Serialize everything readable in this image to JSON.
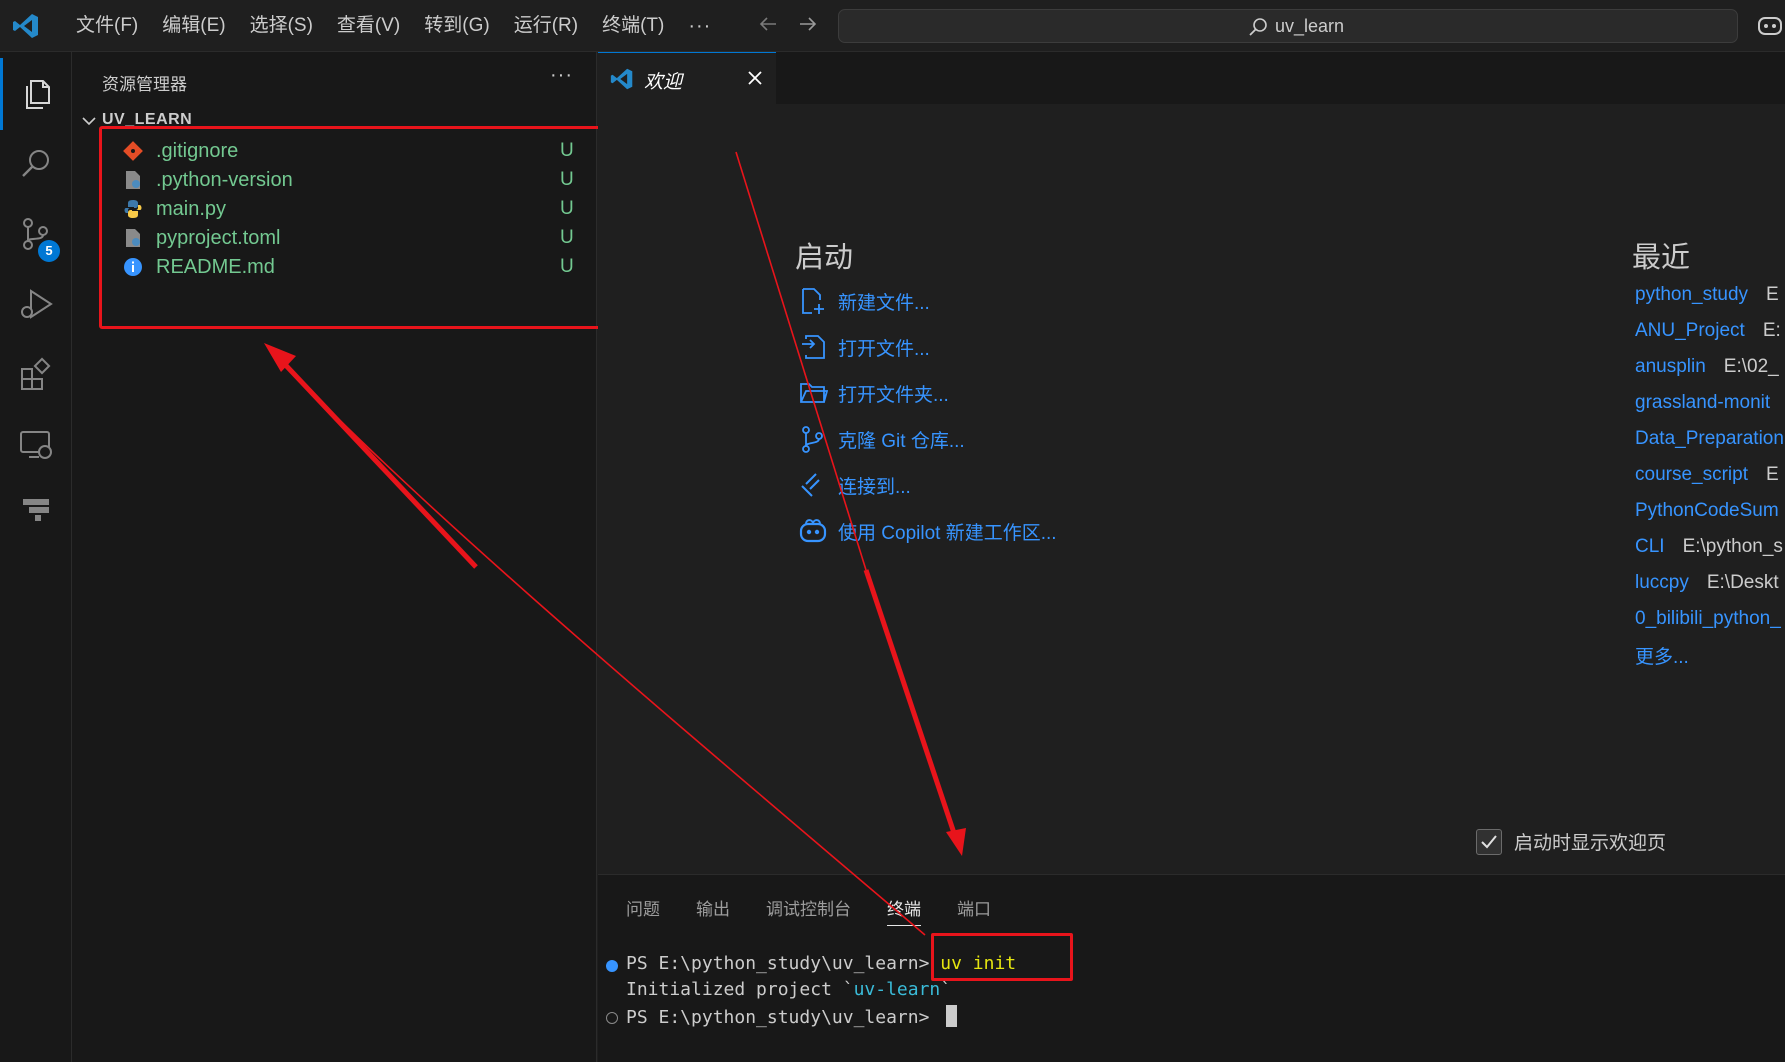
{
  "titlebar": {
    "menus": [
      "文件(F)",
      "编辑(E)",
      "选择(S)",
      "查看(V)",
      "转到(G)",
      "运行(R)",
      "终端(T)"
    ],
    "more": "···",
    "search_text": "uv_learn"
  },
  "activity": {
    "scm_badge": "5"
  },
  "sidebar": {
    "title": "资源管理器",
    "more": "···",
    "folder": "UV_LEARN",
    "files": [
      {
        "name": ".gitignore",
        "status": "U",
        "icon": "git-icon"
      },
      {
        "name": ".python-version",
        "status": "U",
        "icon": "settings-file-icon"
      },
      {
        "name": "main.py",
        "status": "U",
        "icon": "python-icon"
      },
      {
        "name": "pyproject.toml",
        "status": "U",
        "icon": "settings-file-icon"
      },
      {
        "name": "README.md",
        "status": "U",
        "icon": "info-icon"
      }
    ]
  },
  "editor": {
    "tab_label": "欢迎"
  },
  "welcome": {
    "start_title": "启动",
    "start_items": [
      "新建文件...",
      "打开文件...",
      "打开文件夹...",
      "克隆 Git 仓库...",
      "连接到...",
      "使用 Copilot 新建工作区..."
    ],
    "recent_title": "最近",
    "recent": [
      {
        "name": "python_study",
        "path": "E"
      },
      {
        "name": "ANU_Project",
        "path": "E:"
      },
      {
        "name": "anusplin",
        "path": "E:\\02_"
      },
      {
        "name": "grassland-monit",
        "path": ""
      },
      {
        "name": "Data_Preparation",
        "path": ""
      },
      {
        "name": "course_script",
        "path": "E"
      },
      {
        "name": "PythonCodeSum",
        "path": ""
      },
      {
        "name": "CLI",
        "path": "E:\\python_s"
      },
      {
        "name": "luccpy",
        "path": "E:\\Deskt"
      },
      {
        "name": "0_bilibili_python_",
        "path": ""
      }
    ],
    "more_label": "更多...",
    "show_on_startup": "启动时显示欢迎页"
  },
  "panel": {
    "tabs": [
      "问题",
      "输出",
      "调试控制台",
      "终端",
      "端口"
    ],
    "active_tab": "终端",
    "terminal": {
      "prompt1": "PS E:\\python_study\\uv_learn> ",
      "command": "uv init",
      "output_prefix": "Initialized project `",
      "output_name": "uv-learn",
      "output_suffix": "`",
      "prompt2": "PS E:\\python_study\\uv_learn> "
    }
  },
  "colors": {
    "accent": "#0078d4",
    "link": "#3794ff",
    "untracked": "#73c991",
    "annotation": "#e8141b"
  }
}
